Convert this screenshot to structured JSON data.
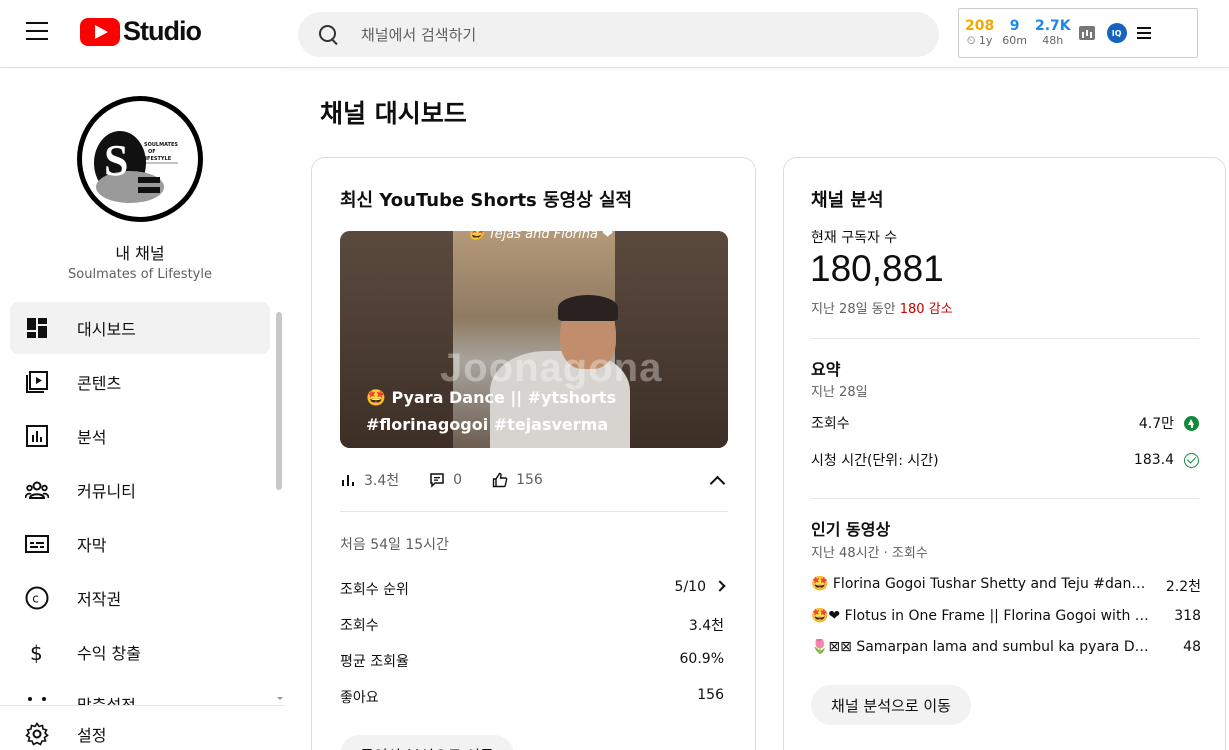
{
  "header": {
    "logo_text": "Studio",
    "search_placeholder": "채널에서 검색하기",
    "ext_stats": [
      {
        "value": "208",
        "label": "⏲ 1y"
      },
      {
        "value": "9",
        "label": "60m"
      },
      {
        "value": "2.7K",
        "label": "48h"
      }
    ],
    "ext_badge": "IQ"
  },
  "sidebar": {
    "channel_label": "내 채널",
    "channel_name": "Soulmates of Lifestyle",
    "avatar_text": "SOULMATES OF LIFESTYLE",
    "items": [
      {
        "label": "대시보드",
        "icon": "dashboard-icon"
      },
      {
        "label": "콘텐츠",
        "icon": "content-icon"
      },
      {
        "label": "분석",
        "icon": "analytics-icon"
      },
      {
        "label": "커뮤니티",
        "icon": "community-icon"
      },
      {
        "label": "자막",
        "icon": "subtitles-icon"
      },
      {
        "label": "저작권",
        "icon": "copyright-icon"
      },
      {
        "label": "수익 창출",
        "icon": "monetization-icon"
      },
      {
        "label": "맞춤설정",
        "icon": "customization-icon"
      }
    ],
    "settings_label": "설정"
  },
  "main": {
    "page_title": "채널 대시보드",
    "shorts_card": {
      "title": "최신 YouTube Shorts 동영상 실적",
      "thumb_top_text": "🤩 Tejas and Florina ❤",
      "thumb_watermark": "Joonagona",
      "thumb_caption": "🤩 Pyara Dance || #ytshorts #florinagogoi #tejasverma",
      "views": "3.4천",
      "comments": "0",
      "likes": "156",
      "since": "처음 54일 15시간",
      "rows": [
        {
          "label": "조회수 순위",
          "value": "5/10"
        },
        {
          "label": "조회수",
          "value": "3.4천"
        },
        {
          "label": "평균 조회율",
          "value": "60.9%"
        },
        {
          "label": "좋아요",
          "value": "156"
        }
      ],
      "button": "동영상 분석으로 이동"
    },
    "analytics_card": {
      "title": "채널 분석",
      "subscribers_label": "현재 구독자 수",
      "subscribers": "180,881",
      "change_prefix": "지난 28일 동안",
      "change_value": "180 감소",
      "summary_title": "요약",
      "summary_period": "지난 28일",
      "summary_rows": [
        {
          "label": "조회수",
          "value": "4.7만"
        },
        {
          "label": "시청 시간(단위: 시간)",
          "value": "183.4"
        }
      ],
      "top_title": "인기 동영상",
      "top_period": "지난 48시간 · 조회수",
      "top_videos": [
        {
          "title": "🤩 Florina Gogoi Tushar Shetty and Teju #dance #ytshorts",
          "value": "2.2천"
        },
        {
          "title": "🤩❤ Flotus in One Frame || Florina Gogoi with Tushar",
          "value": "318"
        },
        {
          "title": "🌷⊠⊠ Samarpan lama and sumbul ka pyara Dance",
          "value": "48"
        }
      ],
      "button": "채널 분석으로 이동"
    }
  }
}
